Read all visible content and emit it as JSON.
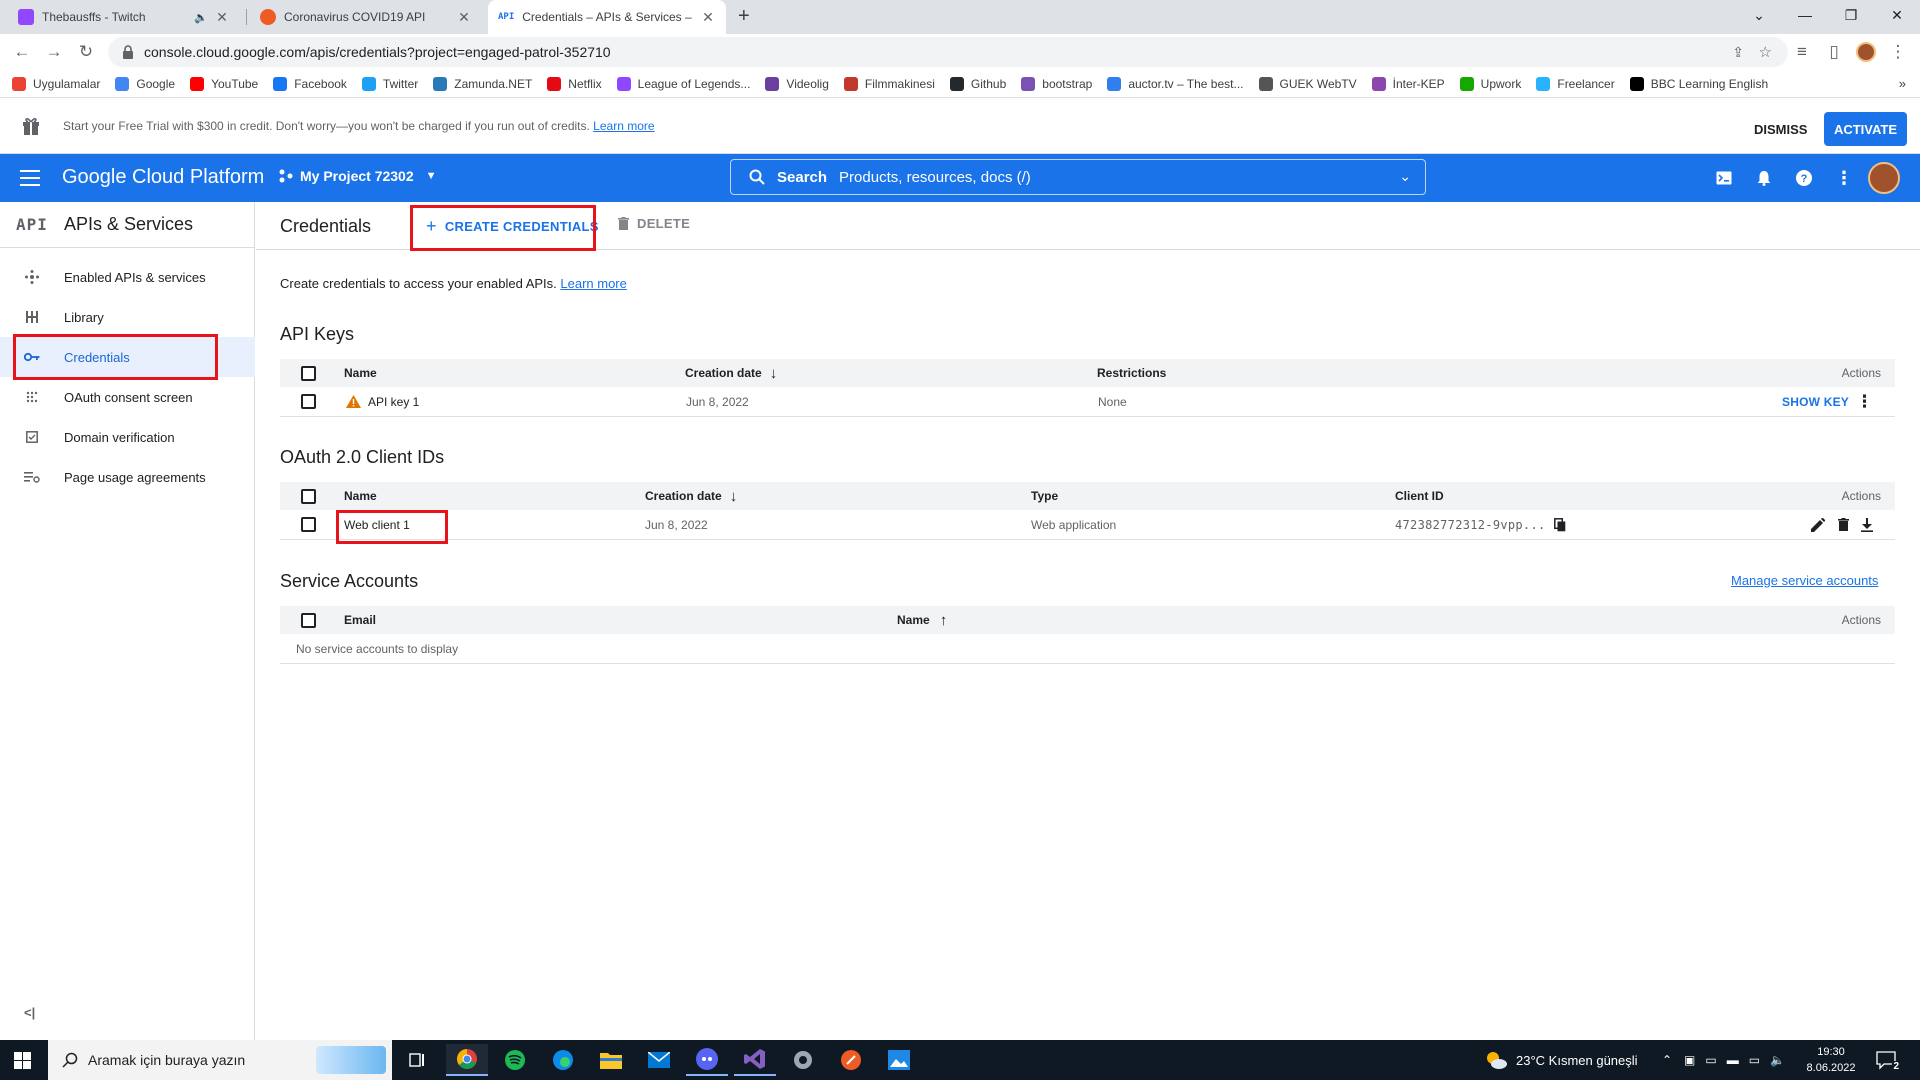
{
  "browser": {
    "tabs": [
      {
        "title": "Thebausffs - Twitch",
        "favicon_color": "#9146ff"
      },
      {
        "title": "Coronavirus COVID19 API",
        "favicon_color": "#ef5b25"
      },
      {
        "title": "Credentials – APIs & Services – My Project",
        "favicon_text": "API"
      }
    ],
    "url": "console.cloud.google.com/apis/credentials?project=engaged-patrol-352710",
    "bookmarks": [
      {
        "label": "Uygulamalar",
        "color": "#ea4335"
      },
      {
        "label": "Google",
        "color": "#4285f4"
      },
      {
        "label": "YouTube",
        "color": "#ff0000"
      },
      {
        "label": "Facebook",
        "color": "#1877f2"
      },
      {
        "label": "Twitter",
        "color": "#1da1f2"
      },
      {
        "label": "Zamunda.NET",
        "color": "#2a7ab8"
      },
      {
        "label": "Netflix",
        "color": "#e50914"
      },
      {
        "label": "League of Legends...",
        "color": "#9146ff"
      },
      {
        "label": "Videolig",
        "color": "#6a3fa0"
      },
      {
        "label": "Filmmakinesi",
        "color": "#c0392b"
      },
      {
        "label": "Github",
        "color": "#24292e"
      },
      {
        "label": "bootstrap",
        "color": "#7952b3"
      },
      {
        "label": "auctor.tv – The best...",
        "color": "#2f80ed"
      },
      {
        "label": "GUEK WebTV",
        "color": "#555555"
      },
      {
        "label": "İnter-KEP",
        "color": "#8e44ad"
      },
      {
        "label": "Upwork",
        "color": "#14a800"
      },
      {
        "label": "Freelancer",
        "color": "#29b2fe"
      },
      {
        "label": "BBC Learning English",
        "color": "#000000"
      }
    ]
  },
  "trial_banner": {
    "text": "Start your Free Trial with $300 in credit. Don't worry—you won't be charged if you run out of credits.",
    "link": "Learn more",
    "dismiss": "DISMISS",
    "activate": "ACTIVATE"
  },
  "header": {
    "brand": "Google Cloud Platform",
    "project": "My Project 72302",
    "search_label": "Search",
    "search_hint": "Products, resources, docs (/)"
  },
  "sidebar": {
    "logo": "API",
    "title": "APIs & Services",
    "items": [
      {
        "label": "Enabled APIs & services",
        "icon": "hub-icon"
      },
      {
        "label": "Library",
        "icon": "library-grid-icon"
      },
      {
        "label": "Credentials",
        "icon": "key-icon",
        "selected": true
      },
      {
        "label": "OAuth consent screen",
        "icon": "consent-dots-icon"
      },
      {
        "label": "Domain verification",
        "icon": "domain-check-icon"
      },
      {
        "label": "Page usage agreements",
        "icon": "settings-list-icon"
      }
    ],
    "collapse": "<|"
  },
  "main": {
    "title": "Credentials",
    "create_button": "CREATE CREDENTIALS",
    "delete_button": "DELETE",
    "intro_text": "Create credentials to access your enabled APIs.",
    "intro_link": "Learn more",
    "api_keys": {
      "title": "API Keys",
      "columns": [
        "Name",
        "Creation date",
        "Restrictions",
        "Actions"
      ],
      "rows": [
        {
          "name": "API key 1",
          "date": "Jun 8, 2022",
          "restrictions": "None",
          "action": "SHOW KEY"
        }
      ]
    },
    "oauth": {
      "title": "OAuth 2.0 Client IDs",
      "columns": [
        "Name",
        "Creation date",
        "Type",
        "Client ID",
        "Actions"
      ],
      "rows": [
        {
          "name": "Web client 1",
          "date": "Jun 8, 2022",
          "type": "Web application",
          "client_id": "472382772312-9vpp..."
        }
      ]
    },
    "service_accounts": {
      "title": "Service Accounts",
      "manage_link": "Manage service accounts",
      "columns": [
        "Email",
        "Name",
        "Actions"
      ],
      "empty": "No service accounts to display"
    }
  },
  "taskbar": {
    "search_placeholder": "Aramak için buraya yazın",
    "weather": "23°C  Kısmen güneşli",
    "time": "19:30",
    "date": "8.06.2022",
    "notifications": "2"
  }
}
